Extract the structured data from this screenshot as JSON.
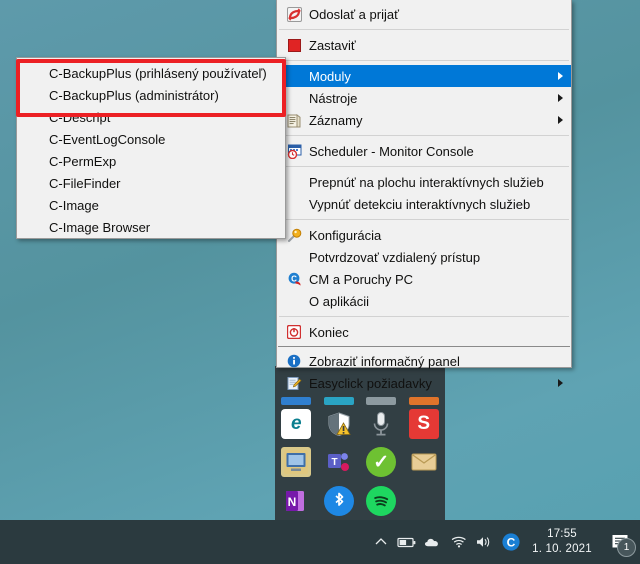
{
  "desktop": {
    "background_color": "#5b9cad"
  },
  "annotation": {
    "name": "red-highlight-rectangle",
    "color": "#ec2024",
    "highlights": [
      "C-BackupPlus (prihlásený používateľ)",
      "C-BackupPlus (administrátor)"
    ]
  },
  "submenu": {
    "name": "moduly-submenu",
    "items": [
      {
        "label": "C-BackupPlus (prihlásený používateľ)",
        "icon": "none",
        "highlighted": true
      },
      {
        "label": "C-BackupPlus (administrátor)",
        "icon": "none",
        "highlighted": true
      },
      {
        "label": "C-Descript",
        "icon": "none",
        "highlighted": false
      },
      {
        "label": "C-EventLogConsole",
        "icon": "none",
        "highlighted": false
      },
      {
        "label": "C-PermExp",
        "icon": "none",
        "highlighted": false
      },
      {
        "label": "C-FileFinder",
        "icon": "none",
        "highlighted": false
      },
      {
        "label": "C-Image",
        "icon": "none",
        "highlighted": false
      },
      {
        "label": "C-Image Browser",
        "icon": "none",
        "highlighted": false
      }
    ]
  },
  "main_menu": {
    "name": "tray-context-menu",
    "selected_item": "Moduly",
    "selection_color": "#0078d7",
    "items": [
      {
        "type": "item",
        "label": "Odoslať a prijať",
        "icon": "send-receive-icon",
        "submenu": false
      },
      {
        "type": "separator"
      },
      {
        "type": "item",
        "label": "Zastaviť",
        "icon": "stop-icon",
        "submenu": false
      },
      {
        "type": "separator"
      },
      {
        "type": "item",
        "label": "Moduly",
        "icon": "none",
        "submenu": true,
        "selected": true
      },
      {
        "type": "item",
        "label": "Nástroje",
        "icon": "none",
        "submenu": true
      },
      {
        "type": "item",
        "label": "Záznamy",
        "icon": "log-icon",
        "submenu": true
      },
      {
        "type": "separator"
      },
      {
        "type": "item",
        "label": "Scheduler - Monitor Console",
        "icon": "scheduler-icon",
        "submenu": false
      },
      {
        "type": "separator"
      },
      {
        "type": "item",
        "label": "Prepnúť na plochu interaktívnych služieb",
        "icon": "none",
        "submenu": false
      },
      {
        "type": "item",
        "label": "Vypnúť detekciu interaktívnych služieb",
        "icon": "none",
        "submenu": false
      },
      {
        "type": "separator"
      },
      {
        "type": "item",
        "label": "Konfigurácia",
        "icon": "key-icon",
        "submenu": false
      },
      {
        "type": "item",
        "label": "Potvrdzovať vzdialený prístup",
        "icon": "none",
        "submenu": false
      },
      {
        "type": "item",
        "label": "CM a Poruchy PC",
        "icon": "cm-icon",
        "submenu": false
      },
      {
        "type": "item",
        "label": "O aplikácii",
        "icon": "none",
        "submenu": false
      },
      {
        "type": "separator"
      },
      {
        "type": "item",
        "label": "Koniec",
        "icon": "power-icon",
        "submenu": false
      },
      {
        "type": "separator-strong"
      },
      {
        "type": "item",
        "label": "Zobraziť informačný panel",
        "icon": "info-icon",
        "submenu": false
      },
      {
        "type": "item",
        "label": "Easyclick požiadavky",
        "icon": "edit-icon",
        "submenu": true
      }
    ]
  },
  "tray_flyout": {
    "name": "hidden-tray-icons-flyout",
    "background_color": "#323f44",
    "rows": [
      [
        {
          "icon": "blue-partial-icon",
          "label": ""
        },
        {
          "icon": "teal-partial-icon",
          "label": ""
        },
        {
          "icon": "grey-partial-icon",
          "label": ""
        },
        {
          "icon": "orange-partial-icon",
          "label": ""
        }
      ],
      [
        {
          "icon": "edge-icon",
          "label": "e"
        },
        {
          "icon": "defender-warning-icon",
          "label": ""
        },
        {
          "icon": "microphone-icon",
          "label": ""
        },
        {
          "icon": "snagit-icon",
          "label": "S"
        }
      ],
      [
        {
          "icon": "remote-desktop-icon",
          "label": ""
        },
        {
          "icon": "teams-icon",
          "label": "T"
        },
        {
          "icon": "green-check-icon",
          "label": "✓"
        },
        {
          "icon": "mail-icon",
          "label": "✉"
        }
      ],
      [
        {
          "icon": "onenote-icon",
          "label": "N"
        },
        {
          "icon": "bluetooth-icon",
          "label": ""
        },
        {
          "icon": "spotify-icon",
          "label": ""
        },
        {
          "icon": "empty-slot",
          "label": ""
        }
      ]
    ]
  },
  "taskbar": {
    "name": "windows-taskbar",
    "background_color": "#2b3a3f",
    "tray_icons": [
      {
        "name": "show-hidden-icons-chevron",
        "glyph": "chevron-up-icon"
      },
      {
        "name": "battery-icon",
        "glyph": "battery-icon"
      },
      {
        "name": "onedrive-icon",
        "glyph": "cloud-icon"
      },
      {
        "name": "network-icon",
        "glyph": "wifi-icon"
      },
      {
        "name": "volume-icon",
        "glyph": "speaker-icon"
      },
      {
        "name": "c-monitor-icon",
        "glyph": "c-circle-icon"
      }
    ],
    "clock": {
      "time": "17:55",
      "date": "1. 10. 2021"
    },
    "notifications": {
      "icon": "action-center-icon",
      "count": "1"
    }
  }
}
